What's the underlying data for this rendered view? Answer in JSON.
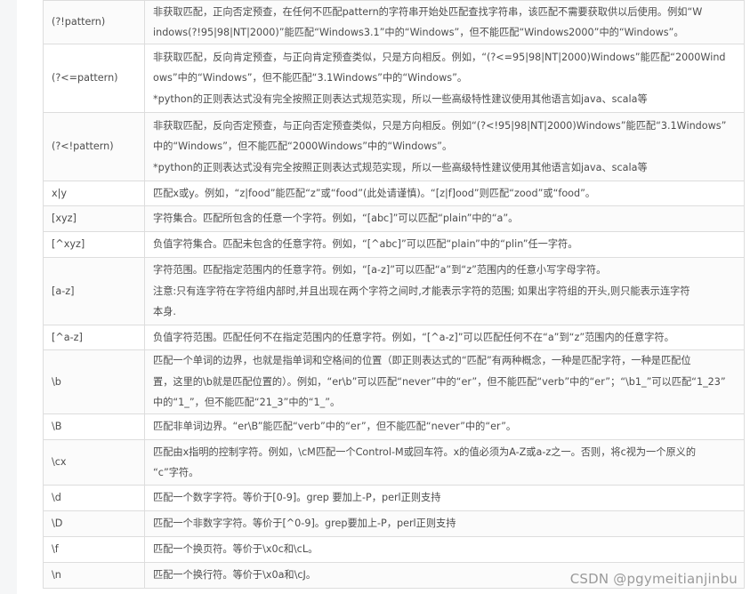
{
  "rows": [
    {
      "pattern": "(?!pattern)",
      "lines": [
        "非获取匹配，正向否定预查，在任何不匹配pattern的字符串开始处匹配查找字符串，该匹配不需要获取供以后使用。例如“W",
        "indows(?!95|98|NT|2000)”能匹配“Windows3.1”中的“Windows”，但不能匹配“Windows2000”中的“Windows”。"
      ]
    },
    {
      "pattern": "(?<=pattern)",
      "lines": [
        "非获取匹配，反向肯定预查，与正向肯定预查类似，只是方向相反。例如，“(?<=95|98|NT|2000)Windows”能匹配“2000Wind",
        "ows”中的“Windows”，但不能匹配“3.1Windows”中的“Windows”。",
        "*python的正则表达式没有完全按照正则表达式规范实现，所以一些高级特性建议使用其他语言如java、scala等"
      ]
    },
    {
      "pattern": "(?<!pattern)",
      "lines": [
        "非获取匹配，反向否定预查，与正向否定预查类似，只是方向相反。例如“(?<!95|98|NT|2000)Windows”能匹配“3.1Windows”",
        "中的“Windows”，但不能匹配“2000Windows”中的“Windows”。",
        "*python的正则表达式没有完全按照正则表达式规范实现，所以一些高级特性建议使用其他语言如java、scala等"
      ]
    },
    {
      "pattern": "x|y",
      "lines": [
        "匹配x或y。例如，“z|food”能匹配“z”或“food”(此处请谨慎)。“[z|f]ood”则匹配“zood”或“food”。"
      ]
    },
    {
      "pattern": "[xyz]",
      "lines": [
        "字符集合。匹配所包含的任意一个字符。例如，“[abc]”可以匹配“plain”中的“a”。"
      ]
    },
    {
      "pattern": "[^xyz]",
      "lines": [
        "负值字符集合。匹配未包含的任意字符。例如，“[^abc]”可以匹配“plain”中的“plin”任一字符。"
      ]
    },
    {
      "pattern": "[a-z]",
      "lines": [
        "字符范围。匹配指定范围内的任意字符。例如，“[a-z]”可以匹配“a”到“z”范围内的任意小写字母字符。",
        "注意:只有连字符在字符组内部时,并且出现在两个字符之间时,才能表示字符的范围; 如果出字符组的开头,则只能表示连字符",
        "本身."
      ]
    },
    {
      "pattern": "[^a-z]",
      "lines": [
        "负值字符范围。匹配任何不在指定范围内的任意字符。例如，“[^a-z]”可以匹配任何不在“a”到“z”范围内的任意字符。"
      ]
    },
    {
      "pattern": "\\b",
      "lines": [
        "匹配一个单词的边界，也就是指单词和空格间的位置（即正则表达式的“匹配”有两种概念，一种是匹配字符，一种是匹配位",
        "置，这里的\\b就是匹配位置的）。例如，“er\\b”可以匹配“never”中的“er”，但不能匹配“verb”中的“er”；“\\b1_”可以匹配“1_23”",
        "中的“1_”，但不能匹配“21_3”中的“1_”。"
      ]
    },
    {
      "pattern": "\\B",
      "lines": [
        "匹配非单词边界。“er\\B”能匹配“verb”中的“er”，但不能匹配“never”中的“er”。"
      ]
    },
    {
      "pattern": "\\cx",
      "lines": [
        "匹配由x指明的控制字符。例如，\\cM匹配一个Control-M或回车符。x的值必须为A-Z或a-z之一。否则，将c视为一个原义的",
        "“c”字符。"
      ]
    },
    {
      "pattern": "\\d",
      "lines": [
        "匹配一个数字字符。等价于[0-9]。grep 要加上-P，perl正则支持"
      ]
    },
    {
      "pattern": "\\D",
      "lines": [
        "匹配一个非数字字符。等价于[^0-9]。grep要加上-P，perl正则支持"
      ]
    },
    {
      "pattern": "\\f",
      "lines": [
        "匹配一个换页符。等价于\\x0c和\\cL。"
      ]
    },
    {
      "pattern": "\\n",
      "lines": [
        "匹配一个换行符。等价于\\x0a和\\cJ。"
      ]
    }
  ],
  "watermark": "CSDN @pgymeitianjinbu"
}
